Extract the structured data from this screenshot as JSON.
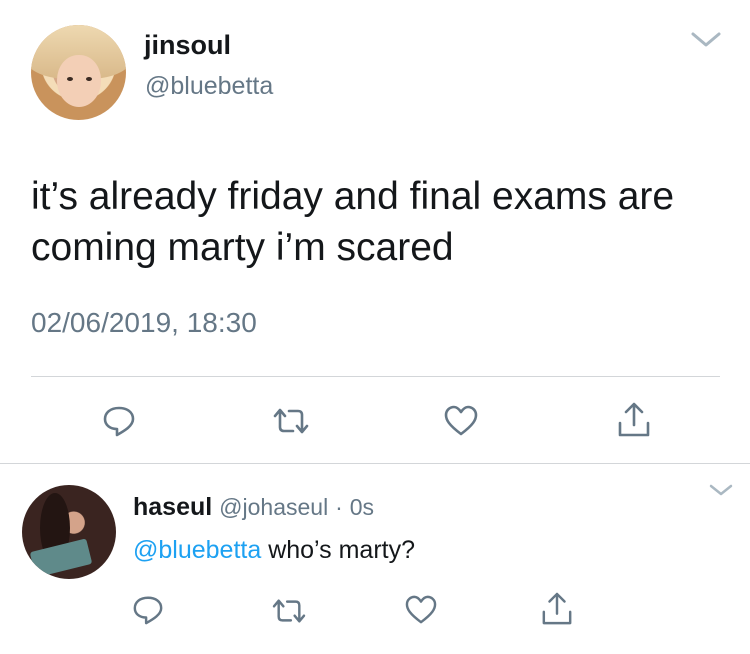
{
  "tweet": {
    "display_name": "jinsoul",
    "handle": "@bluebetta",
    "text": "it’s already friday and final exams are coming marty i’m scared",
    "timestamp": "02/06/2019, 18:30"
  },
  "reply": {
    "display_name": "haseul",
    "handle": "@johaseul",
    "separator": "·",
    "time": "0s",
    "mention": "@bluebetta",
    "text": " who’s marty?"
  },
  "icons": [
    "chevron-down-icon",
    "reply-icon",
    "retweet-icon",
    "like-icon",
    "share-icon"
  ],
  "colors": {
    "mention": "#1da1f2",
    "secondary": "#657786",
    "icon": "#657786"
  }
}
